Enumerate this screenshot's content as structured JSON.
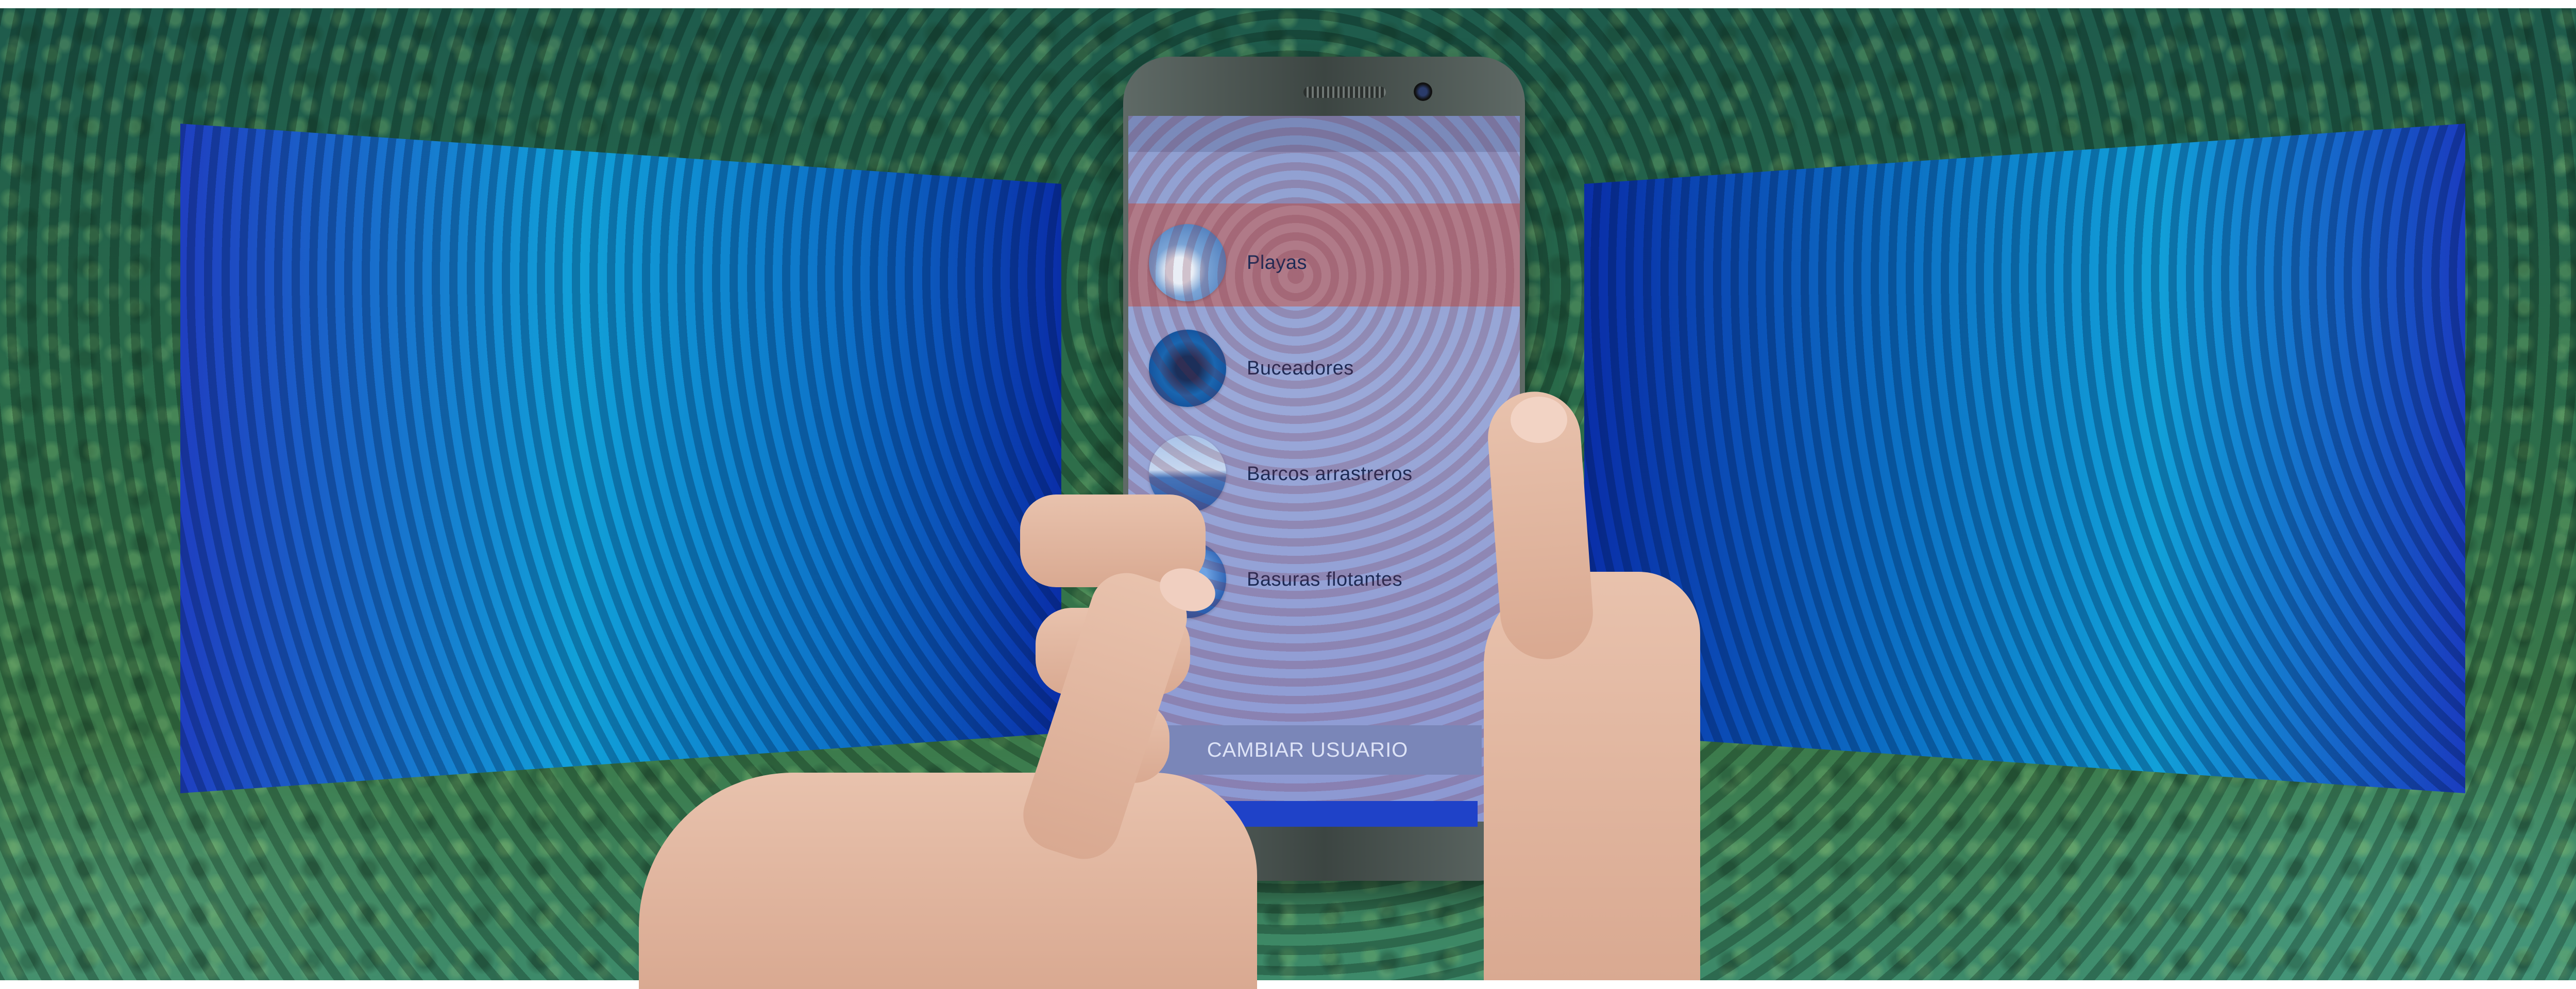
{
  "app": {
    "menu_items": [
      {
        "label": "Playas",
        "icon": "beach-thumbnail"
      },
      {
        "label": "Buceadores",
        "icon": "diver-thumbnail"
      },
      {
        "label": "Barcos arrastreros",
        "icon": "trawler-thumbnail"
      },
      {
        "label": "Basuras flotantes",
        "icon": "floating-trash-thumbnail"
      }
    ],
    "selected_item": "Playas",
    "change_user_label": "CAMBIAR USUARIO"
  },
  "colors": {
    "selected_row": "#b07a88",
    "change_user_button": "#7a86b8",
    "panel_blue": "#11a0d8",
    "forest_green": "#2a6b4a"
  }
}
